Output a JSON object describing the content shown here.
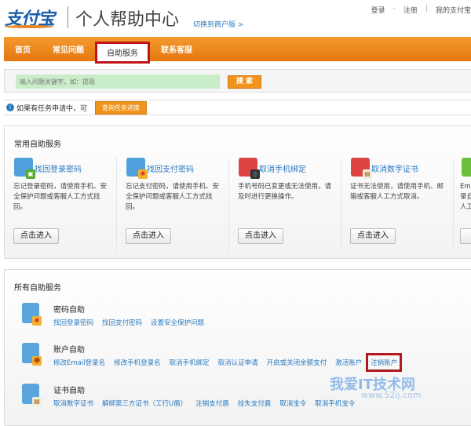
{
  "header": {
    "logo": "支付宝",
    "title": "个人帮助中心",
    "switch_link": "切换到商户版 >",
    "login": "登录",
    "sep": "-",
    "register": "注册",
    "my_alipay": "我的支付宝"
  },
  "nav": {
    "items": [
      "首页",
      "常见问题",
      "自助服务",
      "联系客服"
    ],
    "active": "自助服务"
  },
  "search": {
    "placeholder": "输入问题关键字，如：提现",
    "button": "搜 索"
  },
  "info": {
    "text": "如果有任务申请中，可",
    "button": "查询任务进度"
  },
  "common": {
    "title": "常用自助服务",
    "cards": [
      {
        "name": "找回登录密码",
        "desc": "忘记登录密码，请使用手机、安全保护问题或客服人工方式找回。",
        "button": "点击进入"
      },
      {
        "name": "找回支付密码",
        "desc": "忘记支付密码，请使用手机、安全保护问题或客服人工方式找回。",
        "button": "点击进入"
      },
      {
        "name": "取消手机绑定",
        "desc": "手机号码已变更或无法使用，请及时进行更换操作。",
        "button": "点击进入"
      },
      {
        "name": "取消数字证书",
        "desc": "证书无法使用，请使用手机、邮箱或客服人工方式取消。",
        "button": "点击进入"
      },
      {
        "name": "",
        "desc": "Ema 录自 人工",
        "button": "点"
      }
    ]
  },
  "all": {
    "title": "所有自助服务",
    "groups": [
      {
        "name": "密码自助",
        "links": [
          "找回登录密码",
          "找回支付密码",
          "设置安全保护问题"
        ]
      },
      {
        "name": "账户自助",
        "links": [
          "修改Email登录名",
          "修改手机登录名",
          "取消手机绑定",
          "取消认证申请",
          "开启或关闭余额支付",
          "激活账户",
          "注销账户"
        ]
      },
      {
        "name": "证书自助",
        "links": [
          "取消数字证书",
          "解绑第三方证书（工行U盾）",
          "注销支付盾",
          "挂失支付盾",
          "取消宝令",
          "取消手机宝令"
        ]
      }
    ]
  },
  "watermark": {
    "text": "我爱IT技术网",
    "url": "www.52ij.com"
  }
}
